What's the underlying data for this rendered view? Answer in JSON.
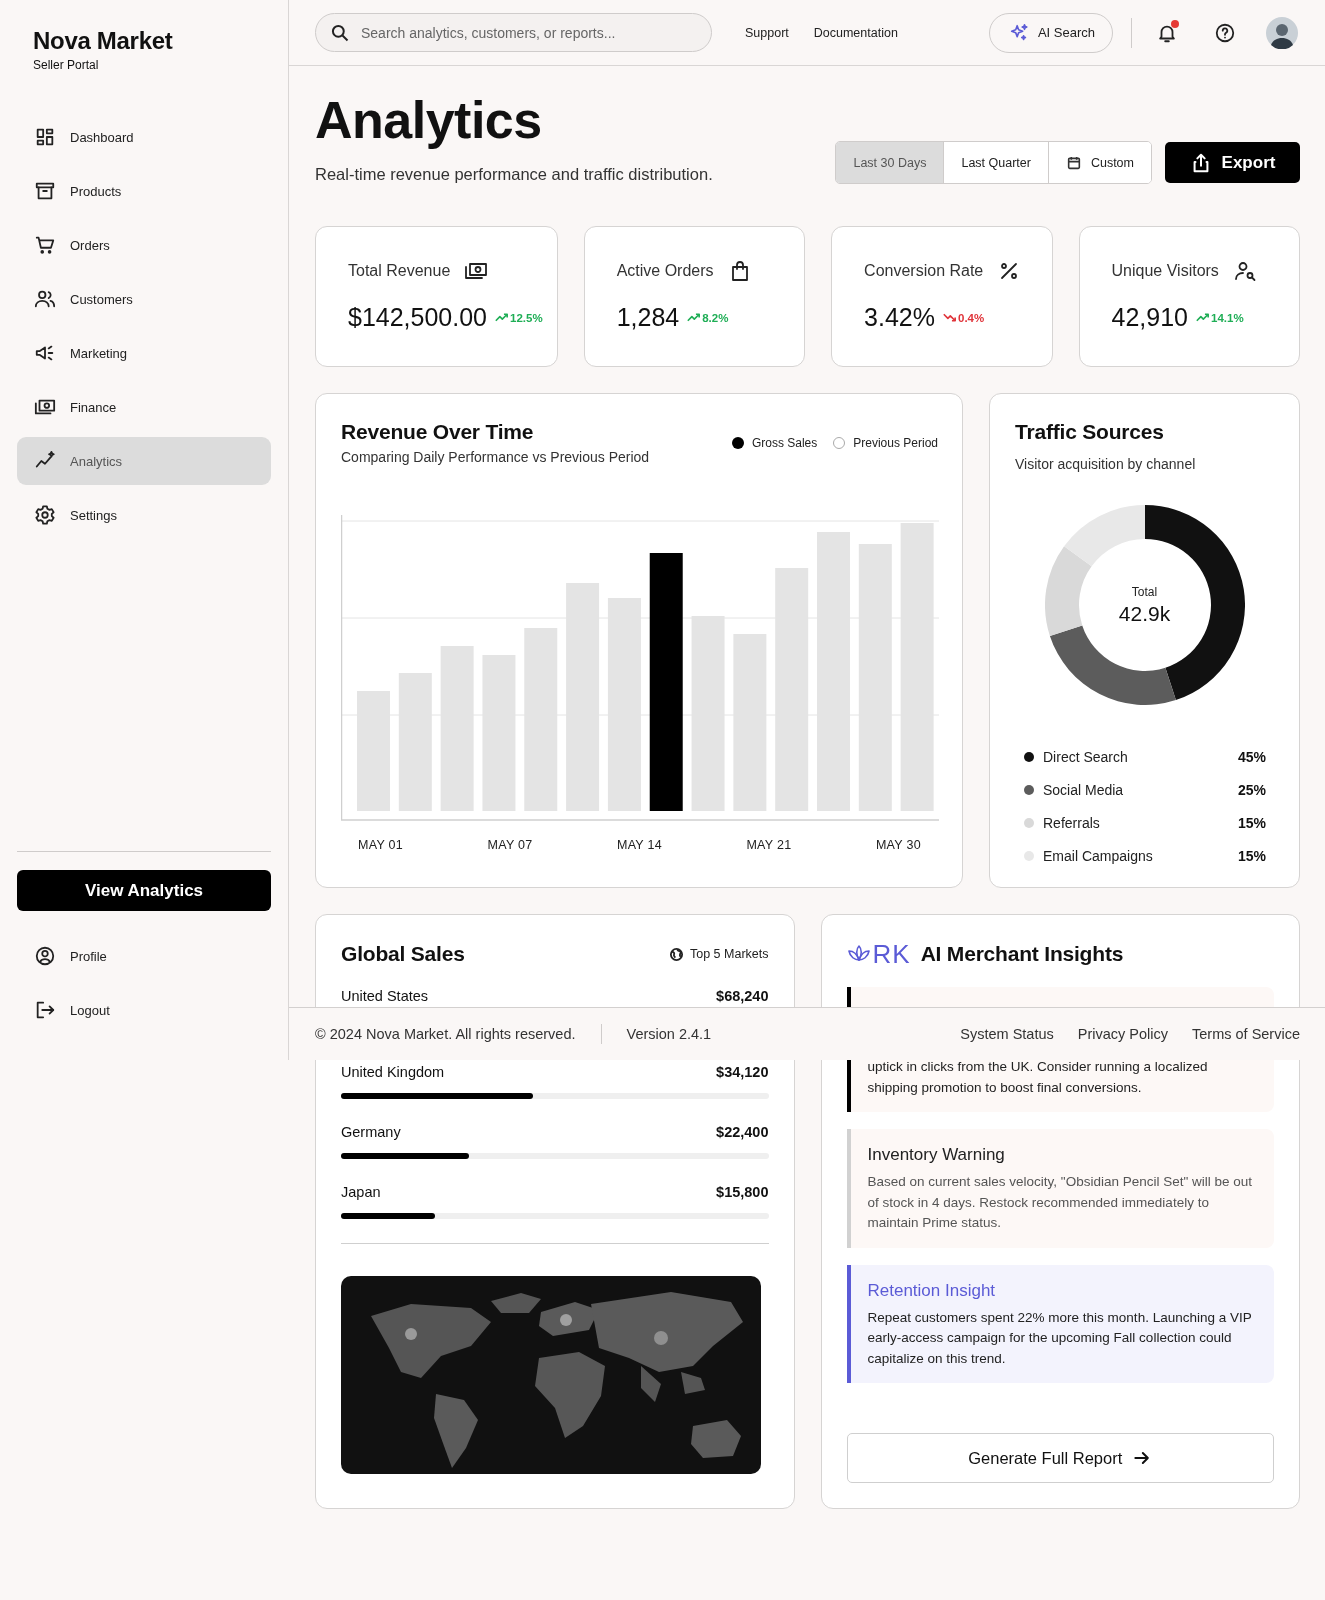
{
  "sidebar": {
    "brand": "Nova Market",
    "subtitle": "Seller Portal",
    "nav": [
      {
        "label": "Dashboard",
        "selected": false
      },
      {
        "label": "Products",
        "selected": false
      },
      {
        "label": "Orders",
        "selected": false
      },
      {
        "label": "Customers",
        "selected": false
      },
      {
        "label": "Marketing",
        "selected": false
      },
      {
        "label": "Finance",
        "selected": false
      },
      {
        "label": "Analytics",
        "selected": true
      },
      {
        "label": "Settings",
        "selected": false
      }
    ],
    "cta": "View Analytics",
    "account": [
      "Profile",
      "Logout"
    ]
  },
  "header": {
    "search_placeholder": "Search analytics, customers, or reports...",
    "links": [
      "Support",
      "Documentation"
    ],
    "ai_button": "AI Search",
    "notifications_unread": true
  },
  "page": {
    "title": "Analytics",
    "subtitle": "Real-time revenue performance and traffic distribution.",
    "ranges": [
      {
        "label": "Last 30 Days",
        "selected": true
      },
      {
        "label": "Last Quarter",
        "selected": false
      },
      {
        "label": "Custom",
        "selected": false
      }
    ],
    "export": "Export"
  },
  "kpis": [
    {
      "label": "Total Revenue",
      "value": "$142,500.00",
      "change": "12.5%",
      "rising": true
    },
    {
      "label": "Active Orders",
      "value": "1,284",
      "change": "8.2%",
      "rising": true
    },
    {
      "label": "Conversion Rate",
      "value": "3.42%",
      "change": "0.4%",
      "rising": false
    },
    {
      "label": "Unique Visitors",
      "value": "42,910",
      "change": "14.1%",
      "rising": true
    }
  ],
  "revenue": {
    "title": "Revenue Over Time",
    "subtitle": "Comparing Daily Performance vs Previous Period",
    "legend": [
      {
        "label": "Gross Sales",
        "kind": "filled"
      },
      {
        "label": "Previous Period",
        "kind": "outline"
      }
    ],
    "x_labels": [
      "MAY 01",
      "MAY 07",
      "MAY 14",
      "MAY 21",
      "MAY 30"
    ]
  },
  "traffic": {
    "title": "Traffic Sources",
    "subtitle": "Visitor acquisition by channel",
    "total_label": "Total",
    "total_value": "42.9k",
    "chart_data": {
      "type": "donut",
      "categories": [
        "Direct Search",
        "Social Media",
        "Referrals",
        "Email Campaigns"
      ],
      "values": [
        45,
        25,
        15,
        15
      ]
    },
    "legend": [
      {
        "value": "45%",
        "color": "#111111"
      },
      {
        "value": "25%",
        "color": "#5c5c5c"
      },
      {
        "value": "15%",
        "color": "#d9d9d9"
      },
      {
        "value": "15%",
        "color": "#e8e8e8"
      }
    ]
  },
  "global_sales": {
    "title": "Global Sales",
    "badge": "Top 5 Markets",
    "rows": [
      {
        "country": "United States",
        "amount": "$68,240"
      },
      {
        "country": "United Kingdom",
        "amount": "$34,120",
        "level": 0.45
      },
      {
        "country": "Germany",
        "amount": "$22,400",
        "level": 0.3
      },
      {
        "country": "Japan",
        "amount": "$15,800",
        "level": 0.22
      }
    ]
  },
  "insights": {
    "logo": "RK",
    "title": "AI Merchant Insights",
    "items": [
      {
        "kind": "alert",
        "body": "uptick in clicks from the UK. Consider running a localized shipping promotion to boost final conversions."
      },
      {
        "kind": "warning",
        "title": "Inventory Warning",
        "body": "Based on current sales velocity, \"Obsidian Pencil Set\" will be out of stock in 4 days. Restock recommended immediately to maintain Prime status."
      },
      {
        "kind": "insight",
        "title": "Retention Insight",
        "body": "Repeat customers spent 22% more this month. Launching a VIP early-access campaign for the upcoming Fall collection could capitalize on this trend."
      }
    ],
    "button": "Generate Full Report"
  },
  "footer": {
    "copyright": "© 2024 Nova Market. All rights reserved.",
    "version": "Version 2.4.1",
    "links": [
      "System Status",
      "Privacy Policy",
      "Terms of Service"
    ]
  }
}
